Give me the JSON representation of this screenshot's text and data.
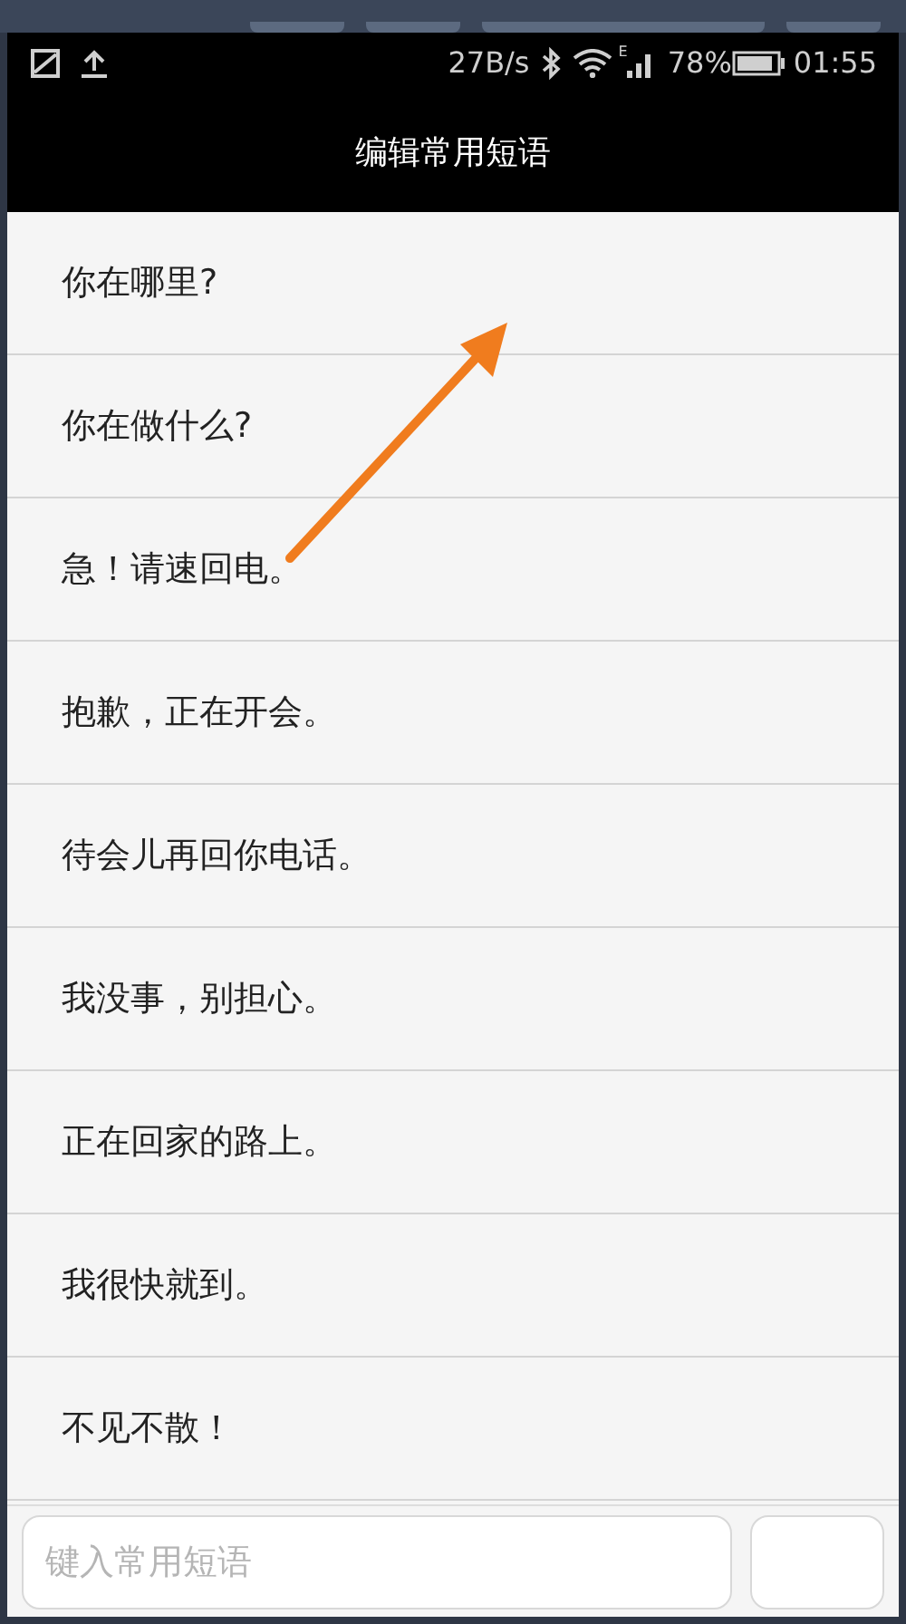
{
  "status_bar": {
    "speed": "27B/s",
    "battery": "78%",
    "time": "01:55",
    "network": "E"
  },
  "title": "编辑常用短语",
  "phrases": [
    {
      "text": "你在哪里?"
    },
    {
      "text": "你在做什么?"
    },
    {
      "text": "急！请速回电。"
    },
    {
      "text": "抱歉，正在开会。"
    },
    {
      "text": "待会儿再回你电话。"
    },
    {
      "text": "我没事，别担心。"
    },
    {
      "text": "正在回家的路上。"
    },
    {
      "text": "我很快就到。"
    },
    {
      "text": "不见不散！"
    }
  ],
  "input": {
    "placeholder": "键入常用短语"
  }
}
